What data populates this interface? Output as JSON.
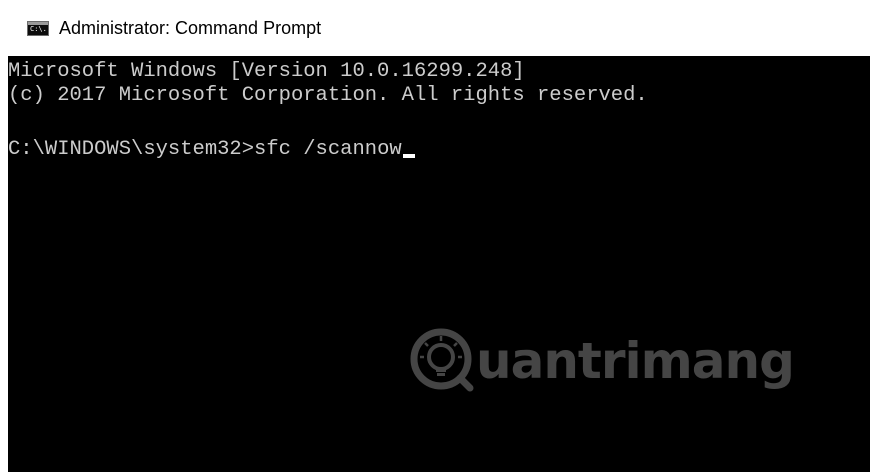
{
  "window": {
    "title": "Administrator: Command Prompt",
    "icon": "command-prompt-icon",
    "icon_glyph": "C:\\."
  },
  "console": {
    "line1": "Microsoft Windows [Version 10.0.16299.248]",
    "line2": "(c) 2017 Microsoft Corporation. All rights reserved.",
    "prompt": "C:\\WINDOWS\\system32>",
    "command": "sfc /scannow"
  },
  "watermark": {
    "text": "uantrimang",
    "logo": "quantrimang-bulb-logo"
  },
  "colors": {
    "console_bg": "#000000",
    "console_text": "#cccccc",
    "titlebar_bg": "#ffffff",
    "watermark": "#7f7f7f"
  }
}
